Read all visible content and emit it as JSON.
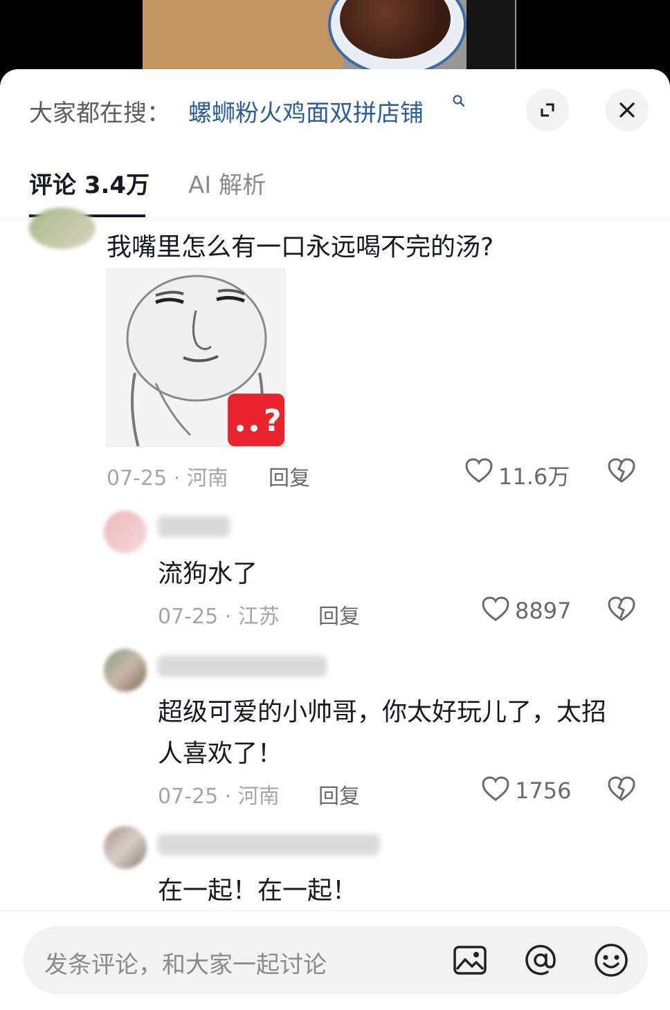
{
  "search_bar": {
    "hint_label": "大家都在搜：",
    "query": "螺蛳粉火鸡面双拼店铺"
  },
  "tabs": [
    {
      "label": "评论 3.4万",
      "active": true
    },
    {
      "label": "AI 解析",
      "active": false
    }
  ],
  "comments": [
    {
      "text": "我嘴里怎么有一口永远喝不完的汤?",
      "date": "07-25",
      "location": "河南",
      "reply_label": "回复",
      "likes": "11.6万"
    },
    {
      "text": "流狗水了",
      "date": "07-25",
      "location": "江苏",
      "reply_label": "回复",
      "likes": "8897"
    },
    {
      "text_line1": "超级可爱的小帅哥，你太好玩儿了，太招",
      "text_line2": "人喜欢了！",
      "date": "07-25",
      "location": "河南",
      "reply_label": "回复",
      "likes": "1756"
    },
    {
      "text": "在一起！在一起！"
    }
  ],
  "composer": {
    "placeholder": "发条评论，和大家一起讨论"
  },
  "icons": {
    "expand": "expand-icon",
    "close": "close-icon",
    "like": "heart-outline-icon",
    "dislike": "broken-heart-icon",
    "image": "image-icon",
    "mention": "at-icon",
    "emoji": "emoji-icon"
  },
  "colors": {
    "link": "#2a5d9c",
    "sticker_badge": "#e8242f"
  }
}
